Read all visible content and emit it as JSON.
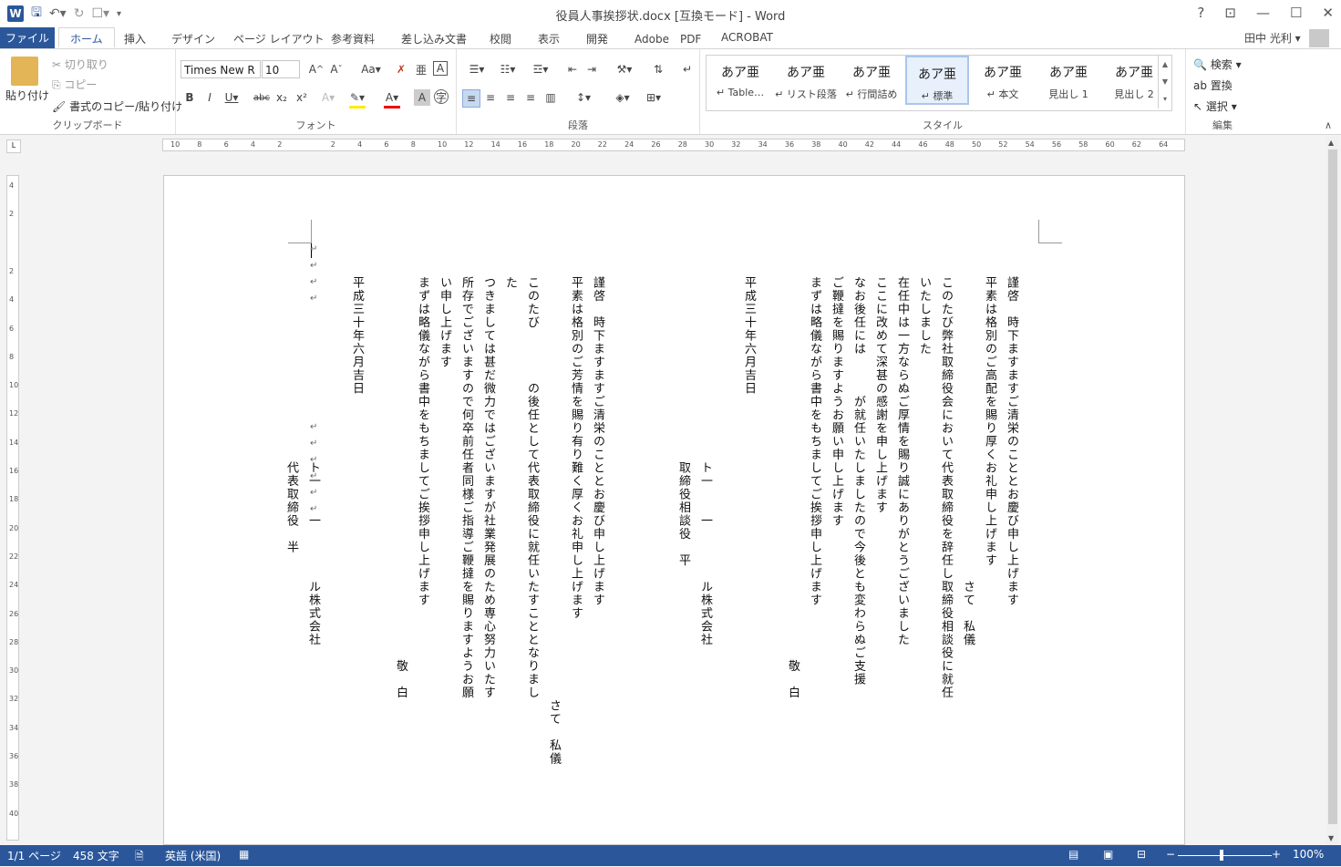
{
  "window": {
    "title": "役員人事挨拶状.docx [互換モード] - Word",
    "controls": [
      "?",
      "⊡",
      "—",
      "☐",
      "✕"
    ]
  },
  "tabs": [
    "ファイル",
    "ホーム",
    "挿入",
    "デザイン",
    "ページ レイアウト",
    "参考資料",
    "差し込み文書",
    "校閲",
    "表示",
    "開発",
    "Adobe　PDF",
    "ACROBAT"
  ],
  "user": {
    "name": "田中 光利"
  },
  "ribbon": {
    "clipboard": {
      "paste": "貼り付け",
      "cut": "切り取り",
      "copy": "コピー",
      "format_painter": "書式のコピー/貼り付け",
      "label": "クリップボード"
    },
    "font": {
      "name": "Times New R",
      "size": "10",
      "label": "フォント"
    },
    "paragraph": {
      "label": "段落"
    },
    "styles": {
      "label": "スタイル",
      "items": [
        {
          "preview": "あア亜",
          "name": "↵ Table…"
        },
        {
          "preview": "あア亜",
          "name": "↵ リスト段落"
        },
        {
          "preview": "あア亜",
          "name": "↵ 行間詰め"
        },
        {
          "preview": "あア亜",
          "name": "↵ 標準"
        },
        {
          "preview": "あア亜",
          "name": "↵ 本文"
        },
        {
          "preview": "あア亜",
          "name": "見出し 1"
        },
        {
          "preview": "あア亜",
          "name": "見出し 2"
        }
      ]
    },
    "editing": {
      "find": "検索",
      "replace": "置換",
      "select": "選択",
      "label": "編集"
    }
  },
  "ruler": {
    "h": [
      "10",
      "8",
      "6",
      "4",
      "2",
      "",
      "2",
      "4",
      "6",
      "8",
      "10",
      "12",
      "14",
      "16",
      "18",
      "20",
      "22",
      "24",
      "26",
      "28",
      "30",
      "32",
      "34",
      "36",
      "38",
      "40",
      "42",
      "44",
      "46",
      "48",
      "50",
      "52",
      "54",
      "56",
      "58",
      "60",
      "62",
      "64"
    ],
    "v": [
      "4",
      "2",
      "",
      "2",
      "4",
      "6",
      "8",
      "10",
      "12",
      "14",
      "16",
      "18",
      "20",
      "22",
      "24",
      "26",
      "28",
      "30",
      "32",
      "34",
      "36",
      "38",
      "40"
    ]
  },
  "document": {
    "right_page": [
      "謹啓　時下ますますご清栄のこととお慶び申し上げます",
      "平素は格別のご高配を賜り厚くお礼申し上げます",
      "　　　　　　　　　　　　　　　　　　　　　　　さて　私儀",
      "このたび弊社取締役会において代表取締役を辞任し取締役相談役に就任",
      "いたしました",
      "在任中は一方ならぬご厚情を賜り誠にありがとうございました",
      "ここに改めて深甚の感謝を申し上げます",
      "なお後任には　　　が就任いたしましたので今後とも変わらぬご支援",
      "ご鞭撻を賜りますようお願い申し上げます",
      "まずは略儀ながら書中をもちましてご挨拶申し上げます",
      "　　　　　　　　　　　　　　　　　　　　　　　　　　　　　敬　白",
      "",
      "平成三十年六月吉日",
      "",
      "　　　　　　　　　　　　　　ト一　　一　　　　ル株式会社",
      "　　　　　　　　　　　　　　取締役相談役　平"
    ],
    "left_page": [
      "謹啓　時下ますますご清栄のこととお慶び申し上げます",
      "平素は格別のご芳情を賜り有り難く厚くお礼申し上げます",
      "　　　　　　　　　　　　　　　　　　　　　　　　　　　　　　　　さて　私儀",
      "このたび　　　　の後任として代表取締役に就任いたすこととなりまし",
      "た",
      "つきましては甚だ微力ではございますが社業発展のため専心努力いたす",
      "所存でございますので何卒前任者同様ご指導ご鞭撻を賜りますようお願",
      "い申し上げます",
      "まずは略儀ながら書中をもちましてご挨拶申し上げます",
      "　　　　　　　　　　　　　　　　　　　　　　　　　　　　　敬　白",
      "",
      "平成三十年六月吉日",
      "",
      "　　　　　　　　　　　　　　ト一　　一　　　　ル株式会社",
      "　　　　　　　　　　　　　　代表取締役　半"
    ]
  },
  "status": {
    "page": "1/1 ページ",
    "words": "458 文字",
    "language": "英語 (米国)",
    "zoom": "100%"
  }
}
